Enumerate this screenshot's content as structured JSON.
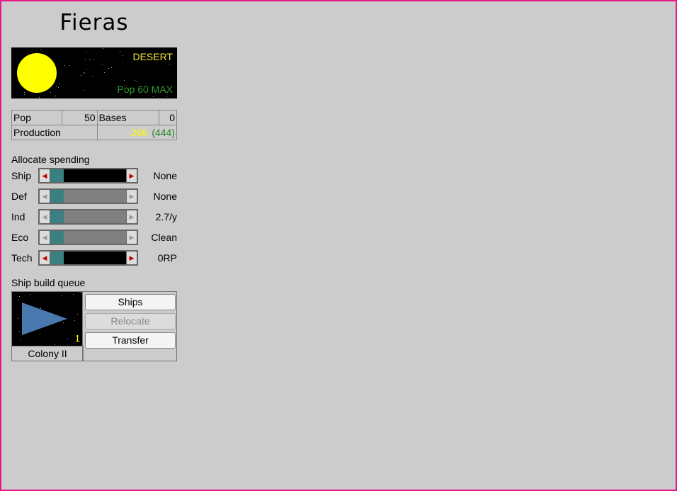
{
  "planet": {
    "name": "Fieras",
    "type": "DESERT",
    "max_pop": "Pop 60 MAX",
    "colors": {
      "globe": "#ffff00",
      "type_text": "#f3e43a",
      "pop_text": "#2f9a2f"
    }
  },
  "stats": {
    "pop_label": "Pop",
    "pop_value": "50",
    "bases_label": "Bases",
    "bases_value": "0",
    "production_label": "Production",
    "production_value": "266",
    "production_total": "(444)"
  },
  "allocation": {
    "heading": "Allocate spending",
    "rows": [
      {
        "label": "Ship",
        "value": "None",
        "enabled": true,
        "level": 0.18
      },
      {
        "label": "Def",
        "value": "None",
        "enabled": false,
        "level": 0.18
      },
      {
        "label": "Ind",
        "value": "2.7/y",
        "enabled": false,
        "level": 0.18
      },
      {
        "label": "Eco",
        "value": "Clean",
        "enabled": false,
        "level": 0.18
      },
      {
        "label": "Tech",
        "value": "0RP",
        "enabled": true,
        "level": 0.18
      }
    ],
    "arrow_left": "◀",
    "arrow_right": "▶"
  },
  "queue": {
    "heading": "Ship build queue",
    "ship_name": "Colony II",
    "ship_count": "1",
    "ship_icon": "colony-ship-icon",
    "buttons": {
      "ships": "Ships",
      "relocate": "Relocate",
      "transfer": "Transfer"
    }
  }
}
